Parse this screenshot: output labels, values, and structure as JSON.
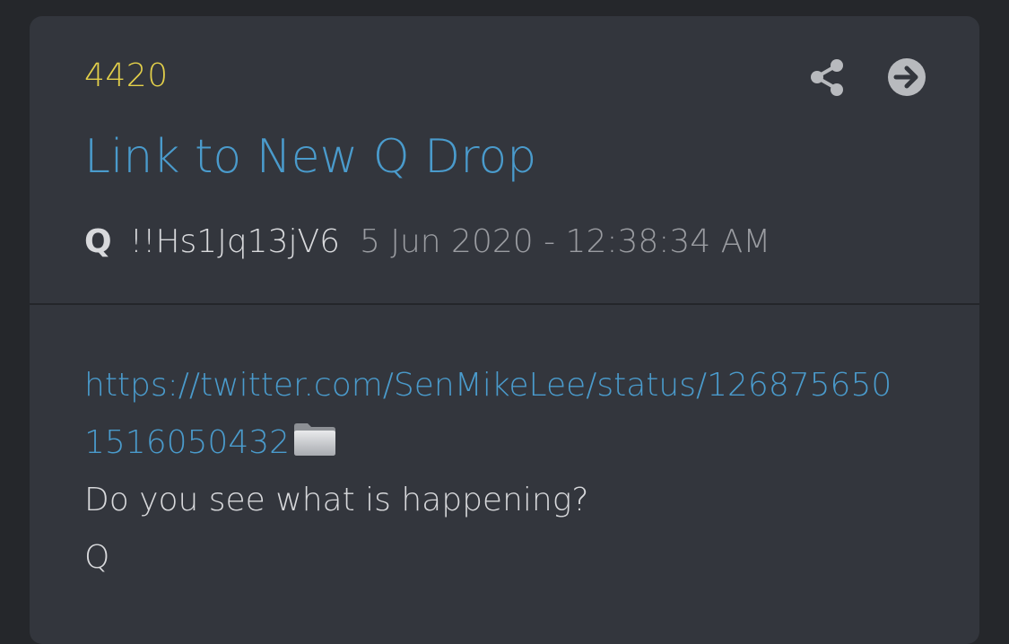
{
  "post": {
    "number": "4420",
    "title": "Link to New Q Drop",
    "author": "Q",
    "tripcode": "!!Hs1Jq13jV6",
    "timestamp": "5 Jun 2020 - 12:38:34 AM",
    "link_line1": "https://twitter.com/SenMikeLee/status/126875650",
    "link_line2": "1516050432",
    "text_line1": "Do you see what is happening?",
    "text_line2": "Q"
  },
  "icons": {
    "share": "share-icon",
    "go": "arrow-right-circle-icon",
    "folder": "folder-icon"
  },
  "colors": {
    "background": "#25272b",
    "card": "#33363d",
    "number": "#e3d04a",
    "link": "#4a9bcc",
    "text": "#d8d9dc",
    "muted": "#9a9ca1"
  }
}
